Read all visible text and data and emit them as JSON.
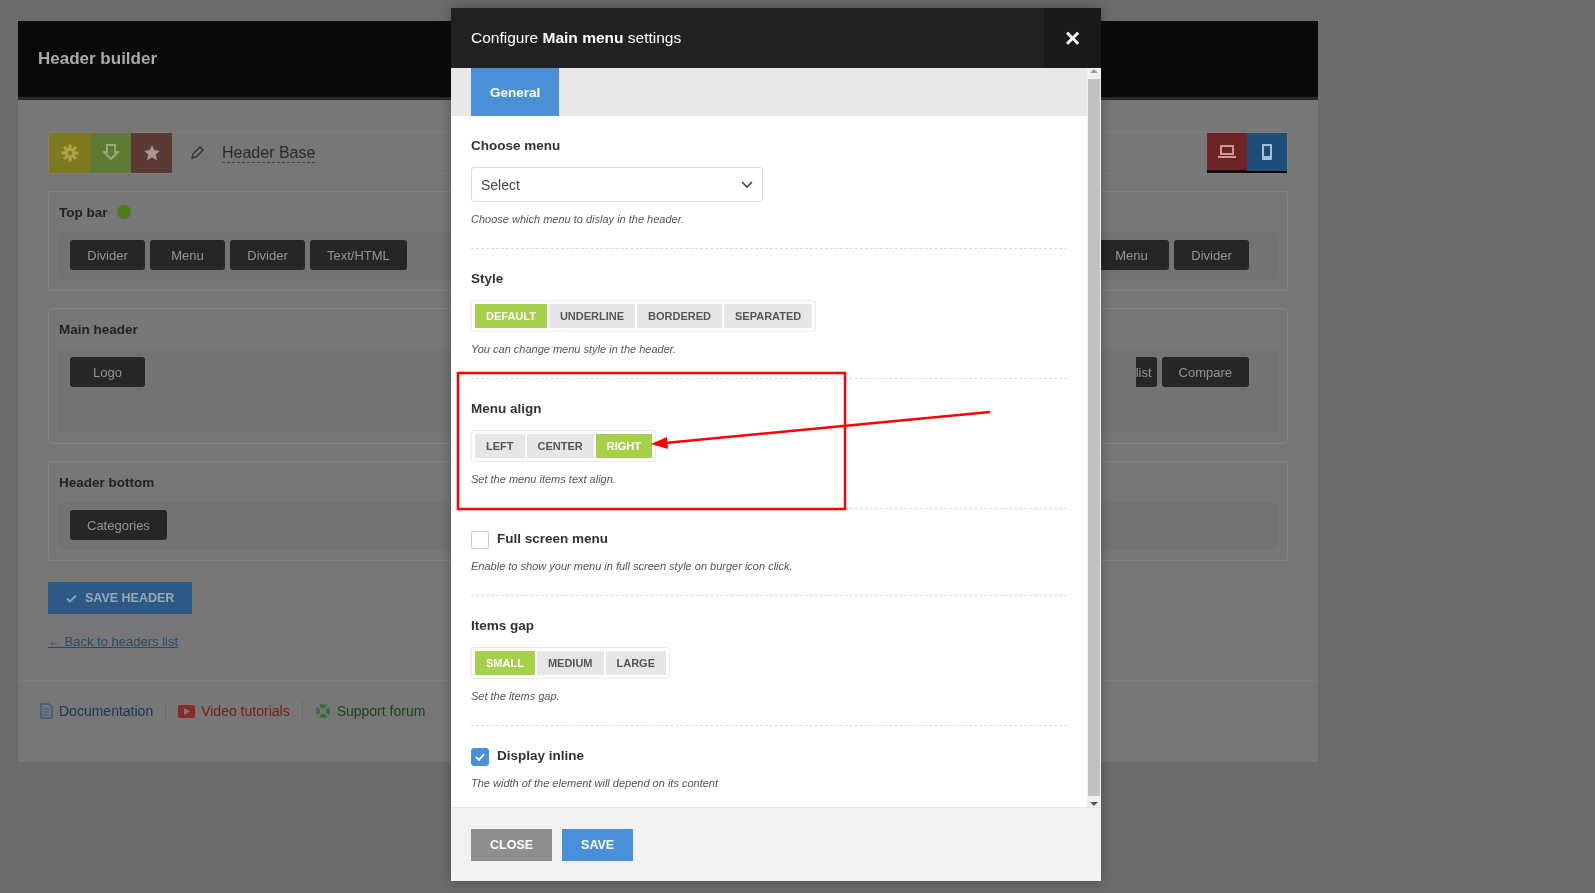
{
  "page": {
    "title": "Header builder",
    "header_name": "Header Base",
    "devices": [
      {
        "selected": true
      },
      {
        "selected": false
      }
    ],
    "sections": [
      {
        "title": "Top bar",
        "indicator": true,
        "left_items": [
          "Divider",
          "Menu",
          "Divider",
          "Text/HTML"
        ],
        "right_items": [
          "Menu",
          "Divider"
        ]
      },
      {
        "title": "Main header",
        "indicator": false,
        "left_items": [
          "Logo"
        ],
        "right_items": [
          "list",
          "Compare"
        ]
      },
      {
        "title": "Header bottom",
        "indicator": false,
        "left_items": [
          "Categories"
        ]
      }
    ],
    "save_button": "SAVE HEADER",
    "back_link": "← Back to headers list",
    "footer_links": [
      "Documentation",
      "Video tutorials",
      "Support forum"
    ]
  },
  "modal": {
    "title": "Configure **Main menu** settings",
    "close": "×",
    "tabs": [
      {
        "label": "General",
        "selected": true
      }
    ],
    "fields": [
      {
        "kind": "select",
        "label": "Choose menu",
        "value": "Select",
        "hint": "Choose which menu to dislay in the header."
      },
      {
        "kind": "segmented",
        "label": "Style",
        "options": [
          {
            "label": "DEFAULT",
            "selected": true
          },
          {
            "label": "UNDERLINE",
            "selected": false
          },
          {
            "label": "BORDERED",
            "selected": false
          },
          {
            "label": "SEPARATED",
            "selected": false
          }
        ],
        "hint": "You can change menu style in the header."
      },
      {
        "kind": "segmented",
        "label": "Menu align",
        "options": [
          {
            "label": "LEFT",
            "selected": false
          },
          {
            "label": "CENTER",
            "selected": false
          },
          {
            "label": "RIGHT",
            "selected": true
          }
        ],
        "hint": "Set the menu items text align."
      },
      {
        "kind": "checkbox",
        "label": "Full screen menu",
        "checked": false,
        "hint": "Enable to show your menu in full screen style on burger icon click."
      },
      {
        "kind": "segmented",
        "label": "Items gap",
        "options": [
          {
            "label": "SMALL",
            "selected": true
          },
          {
            "label": "MEDIUM",
            "selected": false
          },
          {
            "label": "LARGE",
            "selected": false
          }
        ],
        "hint": "Set the items gap."
      },
      {
        "kind": "checkbox",
        "label": "Display inline",
        "checked": true,
        "hint": "The width of the element will depend on its content"
      }
    ],
    "buttons": [
      {
        "kind": "close",
        "label": "CLOSE"
      },
      {
        "kind": "save",
        "label": "SAVE"
      }
    ]
  }
}
